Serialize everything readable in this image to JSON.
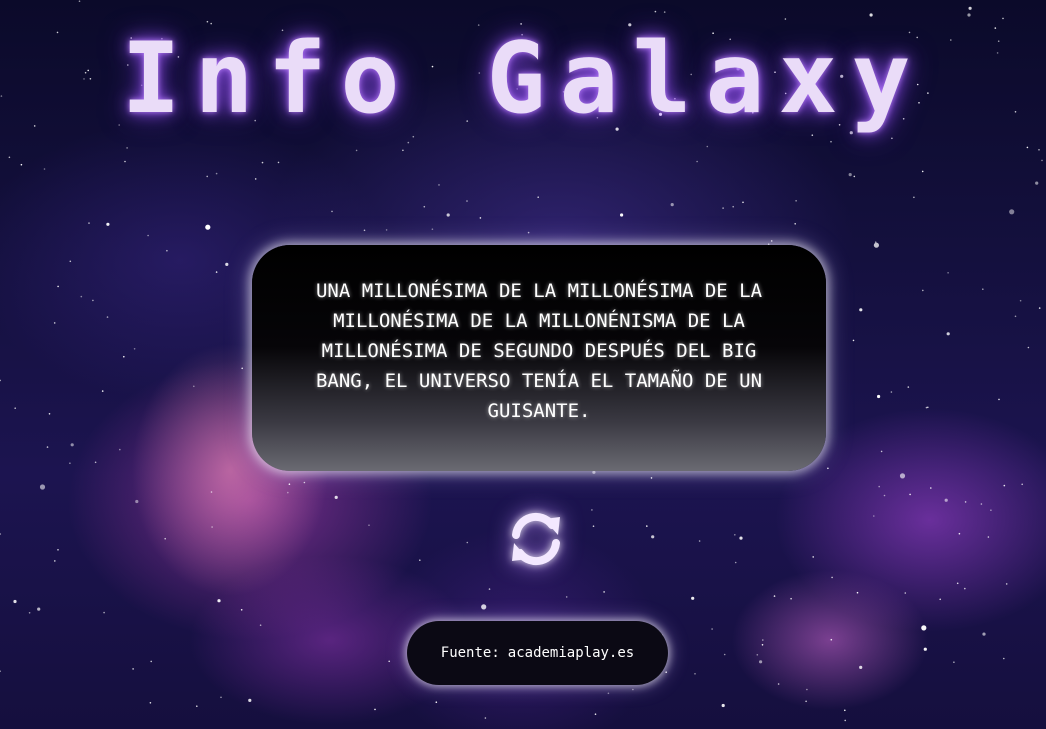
{
  "title": "Info Galaxy",
  "fact": {
    "text": "UNA MILLONÉSIMA DE LA MILLONÉSIMA DE LA MILLONÉSIMA DE LA MILLONÉNISMA DE LA MILLONÉSIMA DE SEGUNDO DESPUÉS DEL BIG BANG, EL UNIVERSO TENÍA EL TAMAÑO DE UN GUISANTE."
  },
  "refresh": {
    "icon": "refresh-icon"
  },
  "source": {
    "label": "Fuente:",
    "link_text": "academiaplay.es"
  },
  "colors": {
    "title_glow": "#a060ff",
    "title_text": "#eadcf8",
    "card_bg": "#000000",
    "background": "#14103e"
  }
}
